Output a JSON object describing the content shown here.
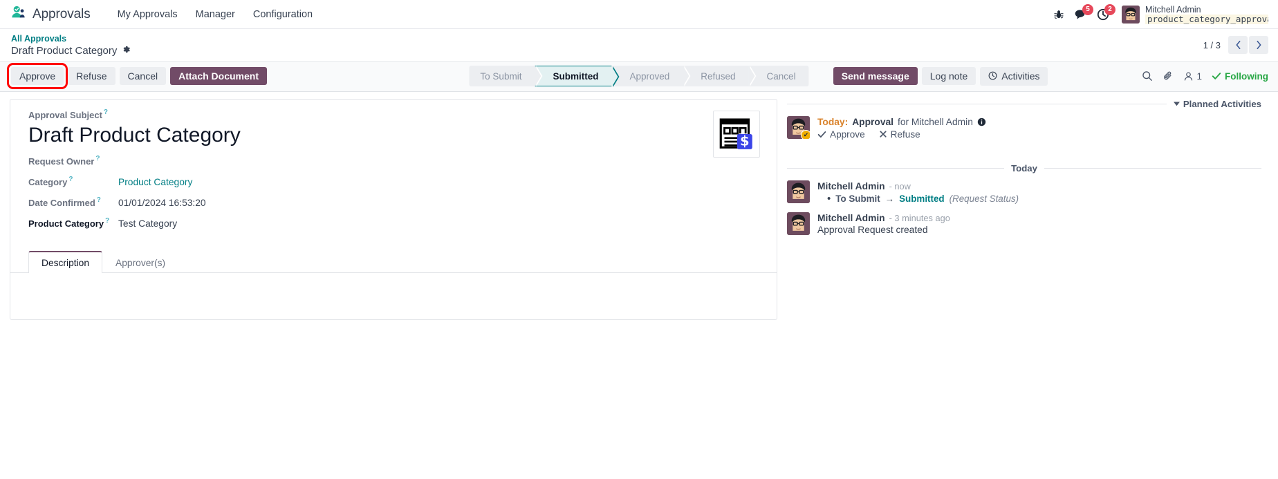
{
  "navbar": {
    "app_name": "Approvals",
    "app_icon": "approvals-app-icon",
    "menu": [
      {
        "label": "My Approvals"
      },
      {
        "label": "Manager"
      },
      {
        "label": "Configuration"
      }
    ],
    "systray": {
      "bug_icon": "bug-icon",
      "messages_icon": "messages-icon",
      "messages_count": "5",
      "activities_icon": "activities-clock-icon",
      "activities_count": "2"
    },
    "user": {
      "name": "Mitchell Admin",
      "database": "product_category_approva…",
      "db_icon": "database-icon",
      "avatar": "user-avatar"
    }
  },
  "breadcrumb": {
    "parent": "All Approvals",
    "current": "Draft Product Category",
    "gear_icon": "gear-icon"
  },
  "pager": {
    "count": "1 / 3",
    "prev_icon": "chevron-left-icon",
    "next_icon": "chevron-right-icon"
  },
  "actions": {
    "approve": "Approve",
    "refuse": "Refuse",
    "cancel": "Cancel",
    "attach_document": "Attach Document",
    "highlighted": "Approve",
    "highlight_color": "#ff0000"
  },
  "statusbar": {
    "active": "Submitted",
    "active_color": "#017e84",
    "stages": [
      {
        "label": "To Submit"
      },
      {
        "label": "Submitted"
      },
      {
        "label": "Approved"
      },
      {
        "label": "Refused"
      },
      {
        "label": "Cancel"
      }
    ]
  },
  "chatter_toolbar": {
    "send_message": "Send message",
    "log_note": "Log note",
    "activities": "Activities",
    "activities_icon": "clock-icon",
    "search_icon": "search-icon",
    "attachment_icon": "paperclip-icon",
    "followers_icon": "user-icon",
    "followers_count": "1",
    "following_label": "Following",
    "following_icon": "check-icon",
    "following_color": "#28a745"
  },
  "form": {
    "subject_label": "Approval Subject",
    "subject_value": "Draft Product Category",
    "document_icon": "document-dollar-icon",
    "fields": [
      {
        "label": "Request Owner",
        "value": "",
        "type": "text",
        "required": false
      },
      {
        "label": "Category",
        "value": "Product Category",
        "type": "link",
        "required": false
      },
      {
        "label": "Date Confirmed",
        "value": "01/01/2024 16:53:20",
        "type": "text",
        "required": false
      },
      {
        "label": "Product Category",
        "value": "Test Category",
        "type": "text",
        "required": true
      }
    ],
    "tabs": [
      {
        "label": "Description",
        "active": true
      },
      {
        "label": "Approver(s)",
        "active": false
      }
    ],
    "description_body": ""
  },
  "chatter": {
    "planned_activities_title": "Planned Activities",
    "caret_icon": "caret-down-icon",
    "activity": {
      "when": "Today:",
      "type": "Approval",
      "assignee": "for Mitchell Admin",
      "info_icon": "info-icon",
      "approve_label": "Approve",
      "approve_icon": "check-icon",
      "refuse_label": "Refuse",
      "refuse_icon": "x-icon"
    },
    "day_divider": "Today",
    "messages": [
      {
        "author": "Mitchell Admin",
        "timestamp": "- now",
        "tracking": {
          "old_value": "To Submit",
          "arrow": "→",
          "new_value": "Submitted",
          "field_name": "(Request Status)"
        }
      },
      {
        "author": "Mitchell Admin",
        "timestamp": "- 3 minutes ago",
        "text": "Approval Request created"
      }
    ]
  }
}
